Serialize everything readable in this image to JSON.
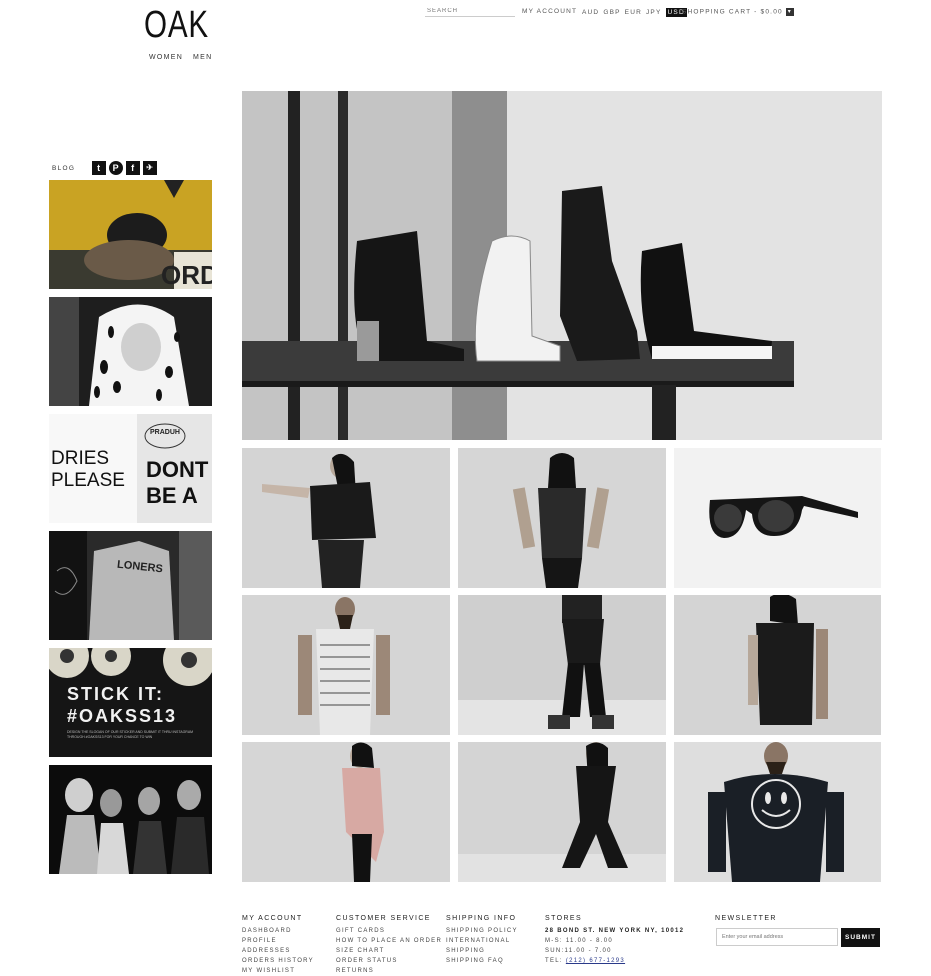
{
  "header": {
    "logo": "OAK",
    "nav": [
      "WOMEN",
      "MEN"
    ],
    "search_placeholder": "SEARCH",
    "my_account": "MY ACCOUNT",
    "currencies": [
      "AUD",
      "GBP",
      "EUR",
      "JPY",
      "USD"
    ],
    "active_currency": "USD",
    "cart": "SHOPPING CART - $0.00",
    "cart_toggle": "▾"
  },
  "sidebar": {
    "blog_label": "BLOG",
    "social": [
      {
        "icon": "tumblr-icon",
        "glyph": "t"
      },
      {
        "icon": "pinterest-icon",
        "glyph": "P"
      },
      {
        "icon": "facebook-icon",
        "glyph": "f"
      },
      {
        "icon": "twitter-icon",
        "glyph": "✈"
      }
    ],
    "tiles": [
      {
        "name": "blog-tile-cap",
        "text": "ORD"
      },
      {
        "name": "blog-tile-hood",
        "text": ""
      },
      {
        "name": "blog-tile-shirts",
        "lines": [
          "DRIES",
          "PLEASE"
        ],
        "right": [
          "DONT",
          "BE A"
        ],
        "stamp": "PRADUH"
      },
      {
        "name": "blog-tile-jacket",
        "text": "LONERS"
      },
      {
        "name": "blog-tile-stickit",
        "title": "STICK IT:",
        "tag": "#OAKSS13",
        "fine": "DESIGN THE SLOGAN OF OUR STICKER AND SUBMIT IT THRU INSTAGRAM THROUGH #OAKSS13 FOR YOUR CHANCE TO WIN"
      },
      {
        "name": "blog-tile-crowd",
        "text": ""
      }
    ]
  },
  "footer": {
    "columns": [
      {
        "title": "MY ACCOUNT",
        "links": [
          "DASHBOARD",
          "PROFILE",
          "ADDRESSES",
          "ORDERS HISTORY",
          "MY WISHLIST"
        ]
      },
      {
        "title": "CUSTOMER SERVICE",
        "links": [
          "GIFT CARDS",
          "HOW TO PLACE AN ORDER",
          "SIZE CHART",
          "ORDER STATUS",
          "RETURNS"
        ]
      },
      {
        "title": "SHIPPING INFO",
        "links": [
          "SHIPPING POLICY",
          "INTERNATIONAL",
          "SHIPPING",
          "SHIPPING FAQ"
        ]
      },
      {
        "title": "STORES",
        "links": [
          "28 BOND ST. NEW YORK NY, 10012",
          "M-S: 11.00 - 8.00",
          "SUN:11.00 - 7.00"
        ],
        "tel_label": "TEL:",
        "tel": "(212) 677-1293"
      }
    ],
    "newsletter": {
      "title": "NEWSLETTER",
      "placeholder": "Enter your email address",
      "submit": "SUBMIT"
    }
  }
}
